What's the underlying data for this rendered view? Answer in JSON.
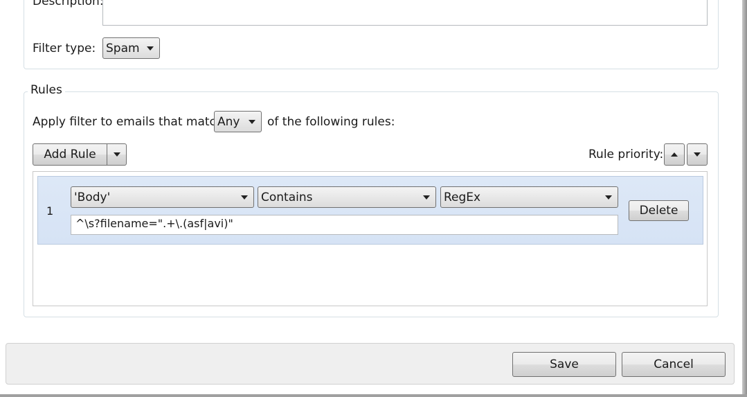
{
  "filter": {
    "description_label": "Description:",
    "description_value": "",
    "filter_type_label": "Filter type:",
    "filter_type_value": "Spam"
  },
  "rules": {
    "group_label": "Rules",
    "apply_prefix": "Apply filter to emails that match",
    "match_value": "Any",
    "apply_suffix": "of the following rules:",
    "add_rule_label": "Add Rule",
    "priority_label": "Rule priority:",
    "items": [
      {
        "number": "1",
        "field": "'Body'",
        "operator": "Contains",
        "match_type": "RegEx",
        "value": "^\\s?filename=\".+\\.(asf|avi)\"",
        "delete_label": "Delete"
      }
    ]
  },
  "footer": {
    "save_label": "Save",
    "cancel_label": "Cancel"
  }
}
